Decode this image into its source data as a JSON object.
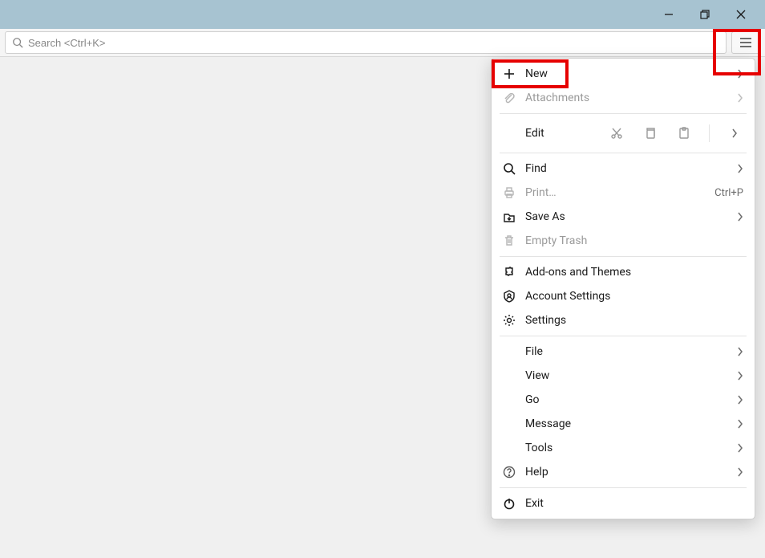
{
  "titlebar": {
    "minimize": "Minimize",
    "maximize": "Maximize",
    "close": "Close"
  },
  "search": {
    "placeholder": "Search <Ctrl+K>"
  },
  "menu": {
    "new": "New",
    "attachments": "Attachments",
    "edit": "Edit",
    "find": "Find",
    "print": "Print…",
    "print_shortcut": "Ctrl+P",
    "save_as": "Save As",
    "empty_trash": "Empty Trash",
    "addons": "Add-ons and Themes",
    "account_settings": "Account Settings",
    "settings": "Settings",
    "file": "File",
    "view": "View",
    "go": "Go",
    "message": "Message",
    "tools": "Tools",
    "help": "Help",
    "exit": "Exit"
  }
}
